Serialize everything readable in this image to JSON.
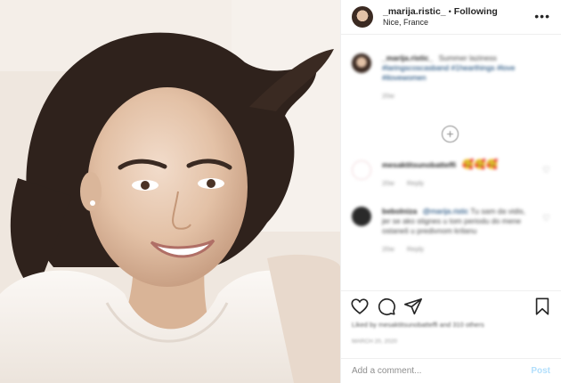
{
  "post": {
    "username": "_marija.ristic_",
    "separator": "•",
    "follow_status": "Following",
    "location": "Nice, France",
    "more_icon": "more-horizontal-icon"
  },
  "caption": {
    "username": "_marija.ristic_",
    "text": "Summer laziness",
    "hashtags": "#laringscoscasband #1hearthings #love #ilovewomen",
    "meta": "20w"
  },
  "comments": [
    {
      "username": "mesaktitsunobatteffi",
      "text": "🥰🥰🥰",
      "time": "20w",
      "reply_label": "Reply"
    },
    {
      "username": "bebolniza",
      "mention": "@marija.ristic",
      "text": "Tu sam da vidis, jer se ako stignes u tom periodu do mene ostaneš u predivnom krilanu",
      "time": "20w",
      "reply_label": "Reply"
    }
  ],
  "actions": {
    "like_icon": "heart-icon",
    "comment_icon": "comment-icon",
    "share_icon": "share-icon",
    "save_icon": "bookmark-icon"
  },
  "likes_text": "Liked by mesaktitsunobatteffi and 310 others",
  "date_text": "March 20, 2020",
  "add_comment": {
    "placeholder": "Add a comment...",
    "post_label": "Post"
  }
}
